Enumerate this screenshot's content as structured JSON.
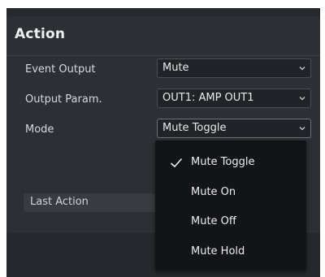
{
  "panel": {
    "title": "Action"
  },
  "fields": {
    "event_output": {
      "label": "Event Output",
      "value": "Mute"
    },
    "output_param": {
      "label": "Output Param.",
      "value": "OUT1: AMP OUT1"
    },
    "mode": {
      "label": "Mode",
      "value": "Mute Toggle"
    }
  },
  "last_action": {
    "label": "Last Action"
  },
  "mode_dropdown": {
    "options": [
      "Mute Toggle",
      "Mute On",
      "Mute Off",
      "Mute Hold"
    ],
    "selected": "Mute Toggle"
  },
  "icons": {
    "chevron": "chevron-down-icon",
    "check": "check-icon"
  },
  "colors": {
    "panel_bg": "#2c3035",
    "app_bg": "#25282c",
    "select_bg": "#202327",
    "dropdown_bg": "#131416",
    "text": "#eceef0"
  }
}
